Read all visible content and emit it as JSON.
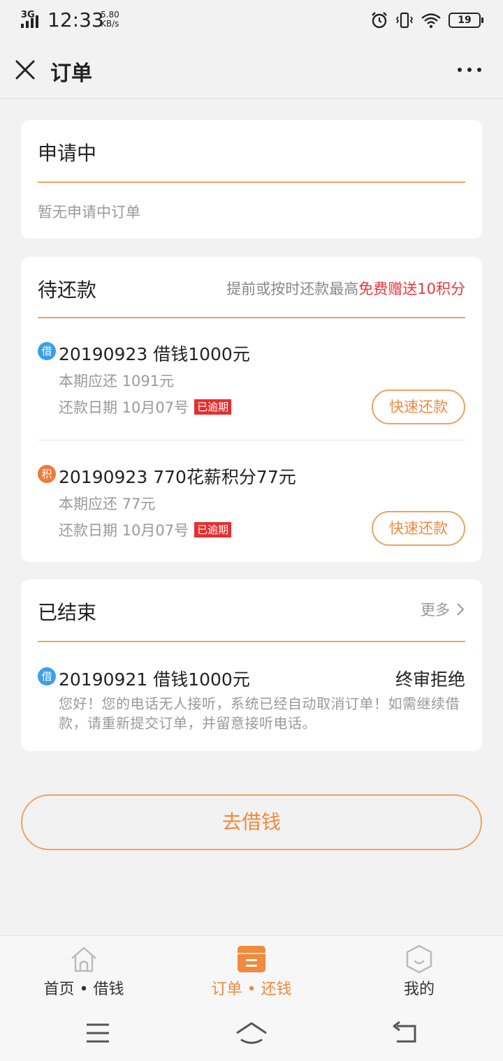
{
  "status_bar": {
    "network": "3G",
    "time": "12:33",
    "speed_value": "5.80",
    "speed_unit": "KB/s",
    "battery": "19",
    "icons": [
      "alarm-icon",
      "vibrate-icon",
      "wifi-icon",
      "battery-icon"
    ]
  },
  "header": {
    "title": "订单",
    "close_icon": "close-icon",
    "more_icon": "more-dots-icon"
  },
  "applying": {
    "title": "申请中",
    "empty_text": "暂无申请中订单"
  },
  "pending": {
    "title": "待还款",
    "note_prefix": "提前或按时还款最高",
    "note_highlight": "免费赠送10积分",
    "orders": [
      {
        "badge": "借",
        "title": "20190923 借钱1000元",
        "amount": "本期应还 1091元",
        "date": "还款日期 10月07号",
        "tag": "已逾期",
        "button": "快速还款"
      },
      {
        "badge": "积",
        "title": "20190923 770花薪积分77元",
        "amount": "本期应还 77元",
        "date": "还款日期 10月07号",
        "tag": "已逾期",
        "button": "快速还款"
      }
    ]
  },
  "finished": {
    "title": "已结束",
    "more": "更多",
    "orders": [
      {
        "badge": "借",
        "title": "20190921 借钱1000元",
        "result": "终审拒绝",
        "desc": "您好！您的电话无人接听，系统已经自动取消订单！如需继续借款，请重新提交订单，并留意接听电话。"
      }
    ]
  },
  "borrow_button": "去借钱",
  "tabs": [
    {
      "label": "首页 • 借钱",
      "icon": "home-icon",
      "active": false
    },
    {
      "label": "订单 • 还钱",
      "icon": "orders-icon",
      "active": true
    },
    {
      "label": "我的",
      "icon": "profile-icon",
      "active": false
    }
  ],
  "colors": {
    "accent": "#f08a3e",
    "divider_accent": "#f0a25e",
    "overdue": "#e52f2f",
    "highlight": "#e5383c",
    "badge_blue": "#3aa0e8",
    "badge_orange": "#f07a3a"
  }
}
